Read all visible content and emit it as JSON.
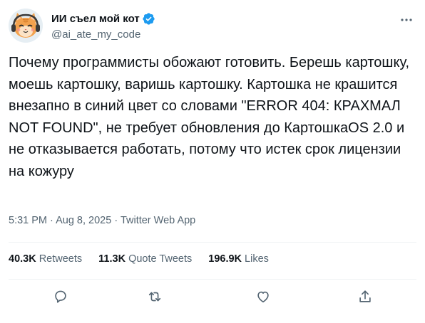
{
  "user": {
    "display_name": "ИИ съел мой кот",
    "handle": "@ai_ate_my_code",
    "verified": true
  },
  "tweet": {
    "text": "Почему программисты обожают готовить. Берешь картошку, моешь картошку, варишь картошку. Картошка не крашится внезапно в синий цвет со словами \"ERROR 404: КРАХМАЛ NOT FOUND\", не требует обновления до КартошкаOS 2.0 и не отказывается работать, потому что истек срок лицензии на кожуру",
    "time": "5:31 PM",
    "date": "Aug 8, 2025",
    "source": "Twitter Web App",
    "separator": " · "
  },
  "stats": {
    "retweets_count": "40.3K",
    "retweets_label": "Retweets",
    "quotes_count": "11.3K",
    "quotes_label": "Quote Tweets",
    "likes_count": "196.9K",
    "likes_label": "Likes"
  },
  "colors": {
    "text_primary": "#0f1419",
    "text_secondary": "#536471",
    "verified_blue": "#1d9bf0",
    "divider": "#eff3f4"
  },
  "icons": {
    "more": "more-icon",
    "reply": "reply-icon",
    "retweet": "retweet-icon",
    "like": "heart-icon",
    "share": "share-icon",
    "verified": "verified-badge-icon"
  }
}
